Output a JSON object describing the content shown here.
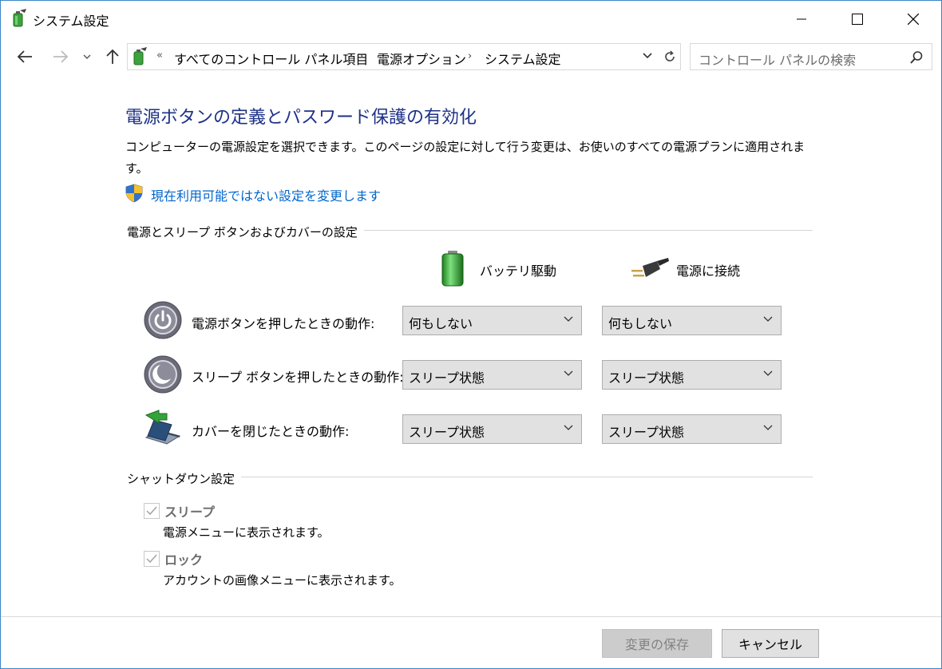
{
  "window": {
    "title": "システム設定",
    "controls": {
      "minimize_icon": "minimize-icon",
      "maximize_icon": "maximize-icon",
      "close_icon": "close-icon"
    }
  },
  "nav": {
    "back_icon": "arrow-left-icon",
    "forward_icon": "arrow-right-icon",
    "recent_icon": "chevron-down-icon",
    "up_icon": "arrow-up-icon",
    "overflow": "«",
    "breadcrumbs": [
      "すべてのコントロール パネル項目",
      "電源オプション",
      "システム設定"
    ],
    "separator": "›",
    "refresh_icon": "refresh-icon",
    "search_placeholder": "コントロール パネルの検索"
  },
  "main": {
    "heading": "電源ボタンの定義とパスワード保護の有効化",
    "description": "コンピューターの電源設定を選択できます。このページの設定に対して行う変更は、お使いのすべての電源プランに適用されます。",
    "admin_link": "現在利用可能ではない設定を変更します",
    "buttons_group": {
      "title": "電源とスリープ ボタンおよびカバーの設定",
      "columns": {
        "battery": "バッテリ駆動",
        "plugged": "電源に接続"
      },
      "rows": [
        {
          "label": "電源ボタンを押したときの動作:",
          "icon": "power-button-icon",
          "battery": "何もしない",
          "plugged": "何もしない"
        },
        {
          "label": "スリープ ボタンを押したときの動作:",
          "icon": "sleep-button-icon",
          "battery": "スリープ状態",
          "plugged": "スリープ状態"
        },
        {
          "label": "カバーを閉じたときの動作:",
          "icon": "laptop-lid-icon",
          "battery": "スリープ状態",
          "plugged": "スリープ状態"
        }
      ]
    },
    "shutdown_group": {
      "title": "シャットダウン設定",
      "items": [
        {
          "label": "スリープ",
          "description": "電源メニューに表示されます。",
          "checked": true,
          "enabled": false
        },
        {
          "label": "ロック",
          "description": "アカウントの画像メニューに表示されます。",
          "checked": true,
          "enabled": false
        }
      ]
    }
  },
  "footer": {
    "save_label": "変更の保存",
    "cancel_label": "キャンセル"
  },
  "colors": {
    "heading": "#1e3287",
    "link": "#0066cc",
    "window_border": "#3a86c8"
  }
}
